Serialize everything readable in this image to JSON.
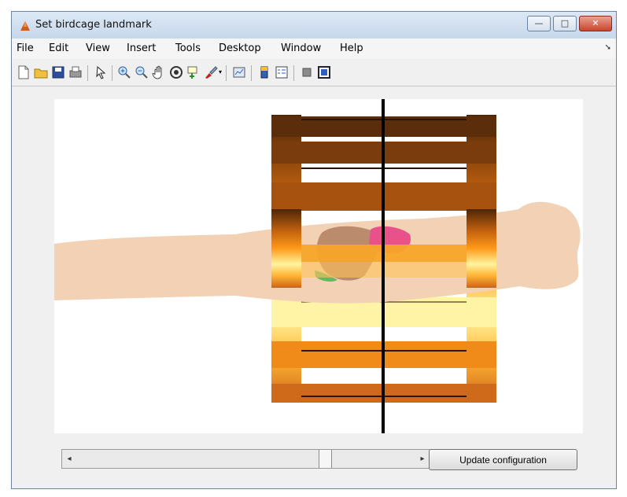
{
  "window": {
    "title": "Set birdcage landmark",
    "controls": {
      "minimize": "—",
      "maximize": "□",
      "close": "✕"
    }
  },
  "menubar": {
    "items": [
      "File",
      "Edit",
      "View",
      "Insert",
      "Tools",
      "Desktop",
      "Window",
      "Help"
    ]
  },
  "toolbar": {
    "buttons": [
      "new-figure-icon",
      "open-file-icon",
      "save-icon",
      "print-icon",
      "pointer-icon",
      "zoom-in-icon",
      "zoom-out-icon",
      "pan-icon",
      "rotate-3d-icon",
      "data-cursor-icon",
      "brush-icon",
      "brush-dropdown-icon",
      "link-plot-icon",
      "colorbar-icon",
      "legend-icon",
      "hide-plot-tools-icon",
      "show-plot-tools-icon"
    ]
  },
  "scene": {
    "body_color": "#f2d1b5",
    "coil_colors": [
      "#4d2606",
      "#c4620f",
      "#ff9a1a",
      "#fff49e"
    ],
    "organ_colors": {
      "liver": "#bb8b6d",
      "heart": "#e9518b",
      "lung": "#65b762"
    }
  },
  "controls": {
    "update_button": "Update configuration"
  }
}
